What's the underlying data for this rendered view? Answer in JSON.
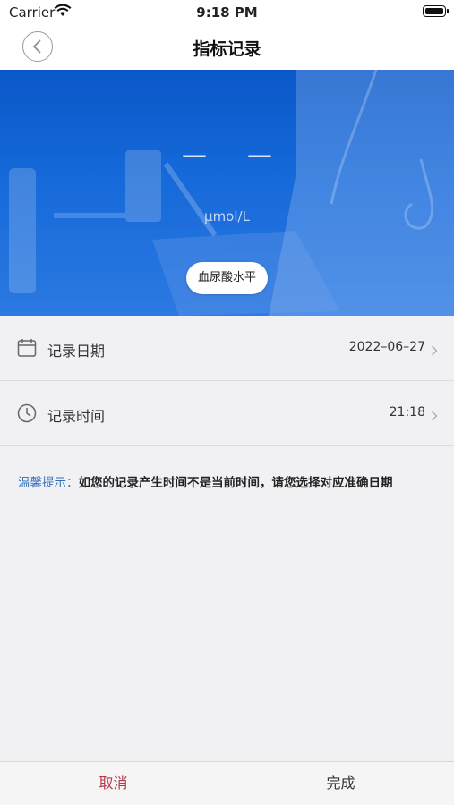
{
  "status_bar": {
    "carrier": "Carrier",
    "time": "9:18 PM"
  },
  "nav": {
    "title": "指标记录",
    "back_icon": "chevron-left-icon"
  },
  "hero": {
    "value": "— —",
    "unit": "µmol/L",
    "indicator_label": "血尿酸水平",
    "accent_color": "#1a6fe0"
  },
  "rows": [
    {
      "label": "记录日期",
      "value": "2022–06–27",
      "icon": "calendar-icon"
    },
    {
      "label": "记录时间",
      "value": "21:18",
      "icon": "clock-icon"
    }
  ],
  "tip": {
    "label": "温馨提示：",
    "text": "如您的记录产生时间不是当前时间，请您选择对应准确日期"
  },
  "bottom": {
    "cancel_label": "取消",
    "done_label": "完成",
    "cancel_color": "#b23a48"
  }
}
